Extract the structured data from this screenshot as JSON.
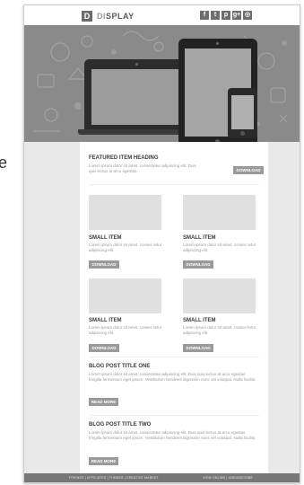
{
  "edge_text": "e",
  "header": {
    "logo_letter": "D",
    "logo_first": "DI",
    "logo_rest": "SPLAY",
    "social": [
      {
        "glyph": "f",
        "icon": "facebook-icon"
      },
      {
        "glyph": "t",
        "icon": "twitter-icon"
      },
      {
        "glyph": "p",
        "icon": "pinterest-icon"
      },
      {
        "glyph": "g+",
        "icon": "google-plus-icon"
      },
      {
        "glyph": "◎",
        "icon": "instagram-icon"
      }
    ]
  },
  "featured": {
    "title": "FEATURED ITEM HEADING",
    "text": "Lorem ipsum dolor sit amet, consectetur adipiscing elit. Duis quis lectus at arcu egestas.",
    "button": "DOWNLOAD"
  },
  "small_items": [
    {
      "title": "SMALL ITEM",
      "text": "Lorem ipsum dolor sit amet, consec tetur adipiscing elit.",
      "button": "DOWNLOAD"
    },
    {
      "title": "SMALL ITEM",
      "text": "Lorem ipsum dolor sit amet, consec tetur adipiscing elit.",
      "button": "DOWNLOAD"
    },
    {
      "title": "SMALL ITEM",
      "text": "Lorem ipsum dolor sit amet, consec tetur adipiscing elit.",
      "button": "DOWNLOAD"
    },
    {
      "title": "SMALL ITEM",
      "text": "Lorem ipsum dolor sit amet, consec tetur adipiscing elit.",
      "button": "DOWNLOAD"
    }
  ],
  "blog_posts": [
    {
      "title": "BLOG POST TITLE ONE",
      "text": "Lorem ipsum dolor sit amet, consectetur adipiscing elit. Duis quis lectus at arcu egestas fringilla fermentum eget ipsum. Vestibulum hendrerit dignissim nunc vel volutpat. Nulla facilisi.",
      "button": "READ MORE"
    },
    {
      "title": "BLOG POST TITLE TWO",
      "text": "Lorem ipsum dolor sit amet, consectetur adipiscing elit. Duis quis lectus at arcu egestas fringilla fermentum eget ipsum. Vestibulum hendrerit dignissim nunc vel volutpat. Nulla facilisi.",
      "button": "READ MORE"
    }
  ],
  "footer": {
    "left_links": "FRIENDS | AFFILIATES | THEMES | CREATIVE MARKET",
    "right_links": "VIEW ONLINE | UNSUBSCRIBE"
  },
  "colors": {
    "hero_bg": "#8a8a8a",
    "button_bg": "#9a9a9a",
    "footer_bg": "#777777"
  }
}
